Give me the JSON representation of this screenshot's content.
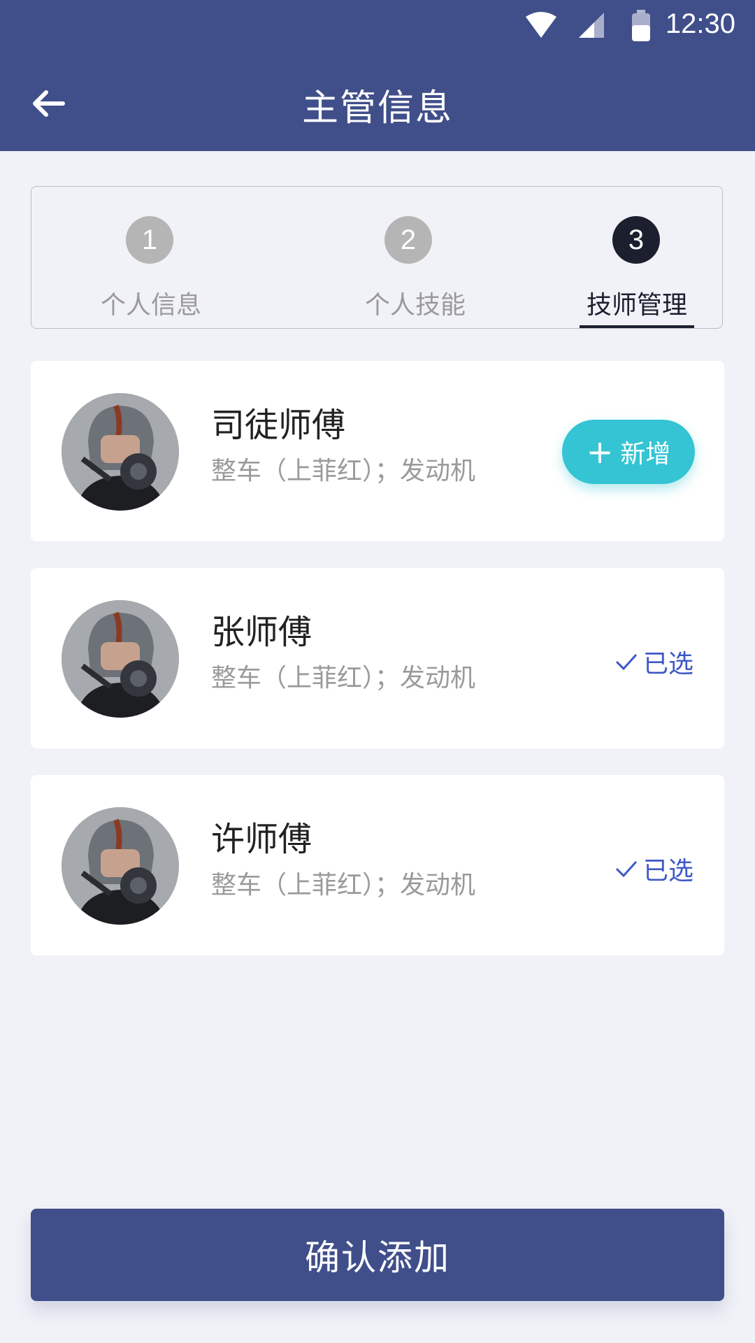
{
  "status_bar": {
    "time": "12:30"
  },
  "header": {
    "title": "主管信息"
  },
  "stepper": {
    "steps": [
      {
        "number": "1",
        "label": "个人信息",
        "active": false
      },
      {
        "number": "2",
        "label": "个人技能",
        "active": false
      },
      {
        "number": "3",
        "label": "技师管理",
        "active": true
      }
    ]
  },
  "technicians": [
    {
      "name": "司徒师傅",
      "specialty": "整车（上菲红）；发动机",
      "action": "新增",
      "action_type": "add"
    },
    {
      "name": "张师傅",
      "specialty": "整车（上菲红）；发动机",
      "action": "已选",
      "action_type": "selected"
    },
    {
      "name": "许师傅",
      "specialty": "整车（上菲红）；发动机",
      "action": "已选",
      "action_type": "selected"
    }
  ],
  "footer": {
    "confirm_label": "确认添加"
  },
  "colors": {
    "primary": "#404f8a",
    "accent": "#34c4d3",
    "selected_text": "#3f58c6",
    "background": "#f1f2f8"
  }
}
